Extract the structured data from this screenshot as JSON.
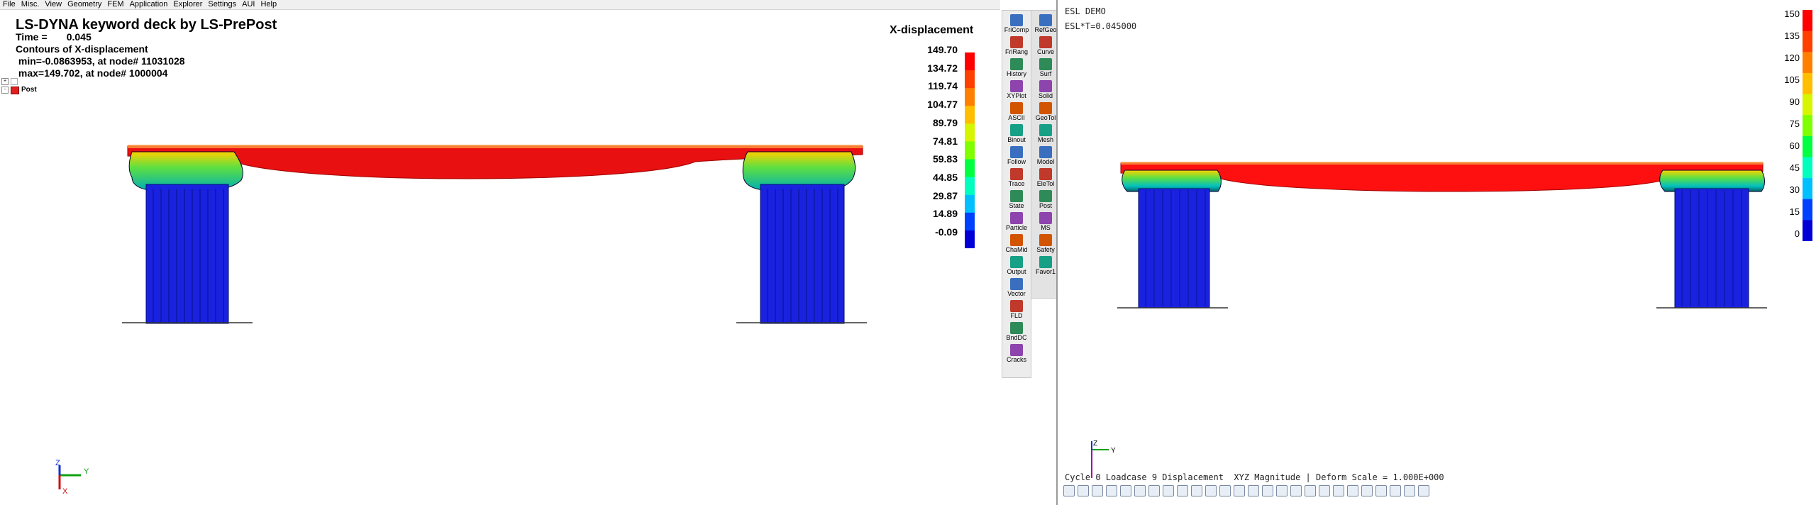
{
  "menu": [
    "File",
    "Misc.",
    "View",
    "Geometry",
    "FEM",
    "Application",
    "Explorer",
    "Settings",
    "AUI",
    "Help"
  ],
  "left": {
    "title": "LS-DYNA keyword deck by LS-PrePost",
    "time_line": "Time =       0.045",
    "contour_line": "Contours of X-displacement",
    "min_line": " min=-0.0863953, at node# 11031028",
    "max_line": " max=149.702, at node# 1000004",
    "tree_item": "Post",
    "axis_labels": {
      "x": "X",
      "y": "Y",
      "z": "Z"
    }
  },
  "legend": {
    "title": "X-displacement",
    "labels": [
      "149.70",
      "134.72",
      "119.74",
      "104.77",
      "89.79",
      "74.81",
      "59.83",
      "44.85",
      "29.87",
      "14.89",
      "-0.09"
    ],
    "colors": [
      "#ff0000",
      "#ff4000",
      "#ff8000",
      "#ffbf00",
      "#d5f500",
      "#80ff00",
      "#00ff40",
      "#00ffbf",
      "#00bfff",
      "#0040ff",
      "#0000d6"
    ]
  },
  "toolbar": {
    "col1": [
      "FriComp",
      "FriRang",
      "History",
      "XYPlot",
      "ASCII",
      "Binout",
      "Follow",
      "Trace",
      "State",
      "Particle",
      "ChaMid",
      "Output",
      "Vector",
      "FLD",
      "BndDC",
      "Cracks"
    ],
    "col2": [
      "RefGeo",
      "Curve",
      "Surf",
      "Solid",
      "GeoTol",
      "Mesh",
      "Model",
      "EleTol",
      "Post",
      "MS",
      "Safety",
      "Favor1"
    ],
    "icon_colors": [
      "#3a6fc0",
      "#c0392b",
      "#2e8b57",
      "#8e44ad",
      "#d35400",
      "#16a085"
    ]
  },
  "right": {
    "title": "ESL DEMO",
    "time_line": "ESL*T=0.045000",
    "status": "Cycle 0 Loadcase 9 Displacement  XYZ Magnitude | Deform Scale = 1.000E+000",
    "legend_labels": [
      "150",
      "135",
      "120",
      "105",
      "90",
      "75",
      "60",
      "45",
      "30",
      "15",
      "0"
    ],
    "axis_labels": {
      "y": "Y",
      "z": "Z"
    }
  }
}
